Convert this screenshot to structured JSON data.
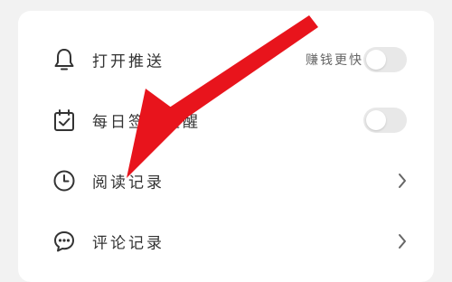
{
  "settings": {
    "items": [
      {
        "label": "打开推送",
        "hint": "赚钱更快",
        "control": "toggle",
        "on": false,
        "icon": "bell-icon"
      },
      {
        "label": "每日签到提醒",
        "hint": "",
        "control": "toggle",
        "on": false,
        "icon": "calendar-check-icon"
      },
      {
        "label": "阅读记录",
        "hint": "",
        "control": "chevron",
        "icon": "clock-icon"
      },
      {
        "label": "评论记录",
        "hint": "",
        "control": "chevron",
        "icon": "comment-icon"
      }
    ]
  },
  "colors": {
    "background": "#f2f2f2",
    "card": "#ffffff",
    "text": "#333333",
    "hint": "#666666",
    "toggle_off": "#e8e8e8",
    "annotation_arrow": "#e8141c"
  }
}
